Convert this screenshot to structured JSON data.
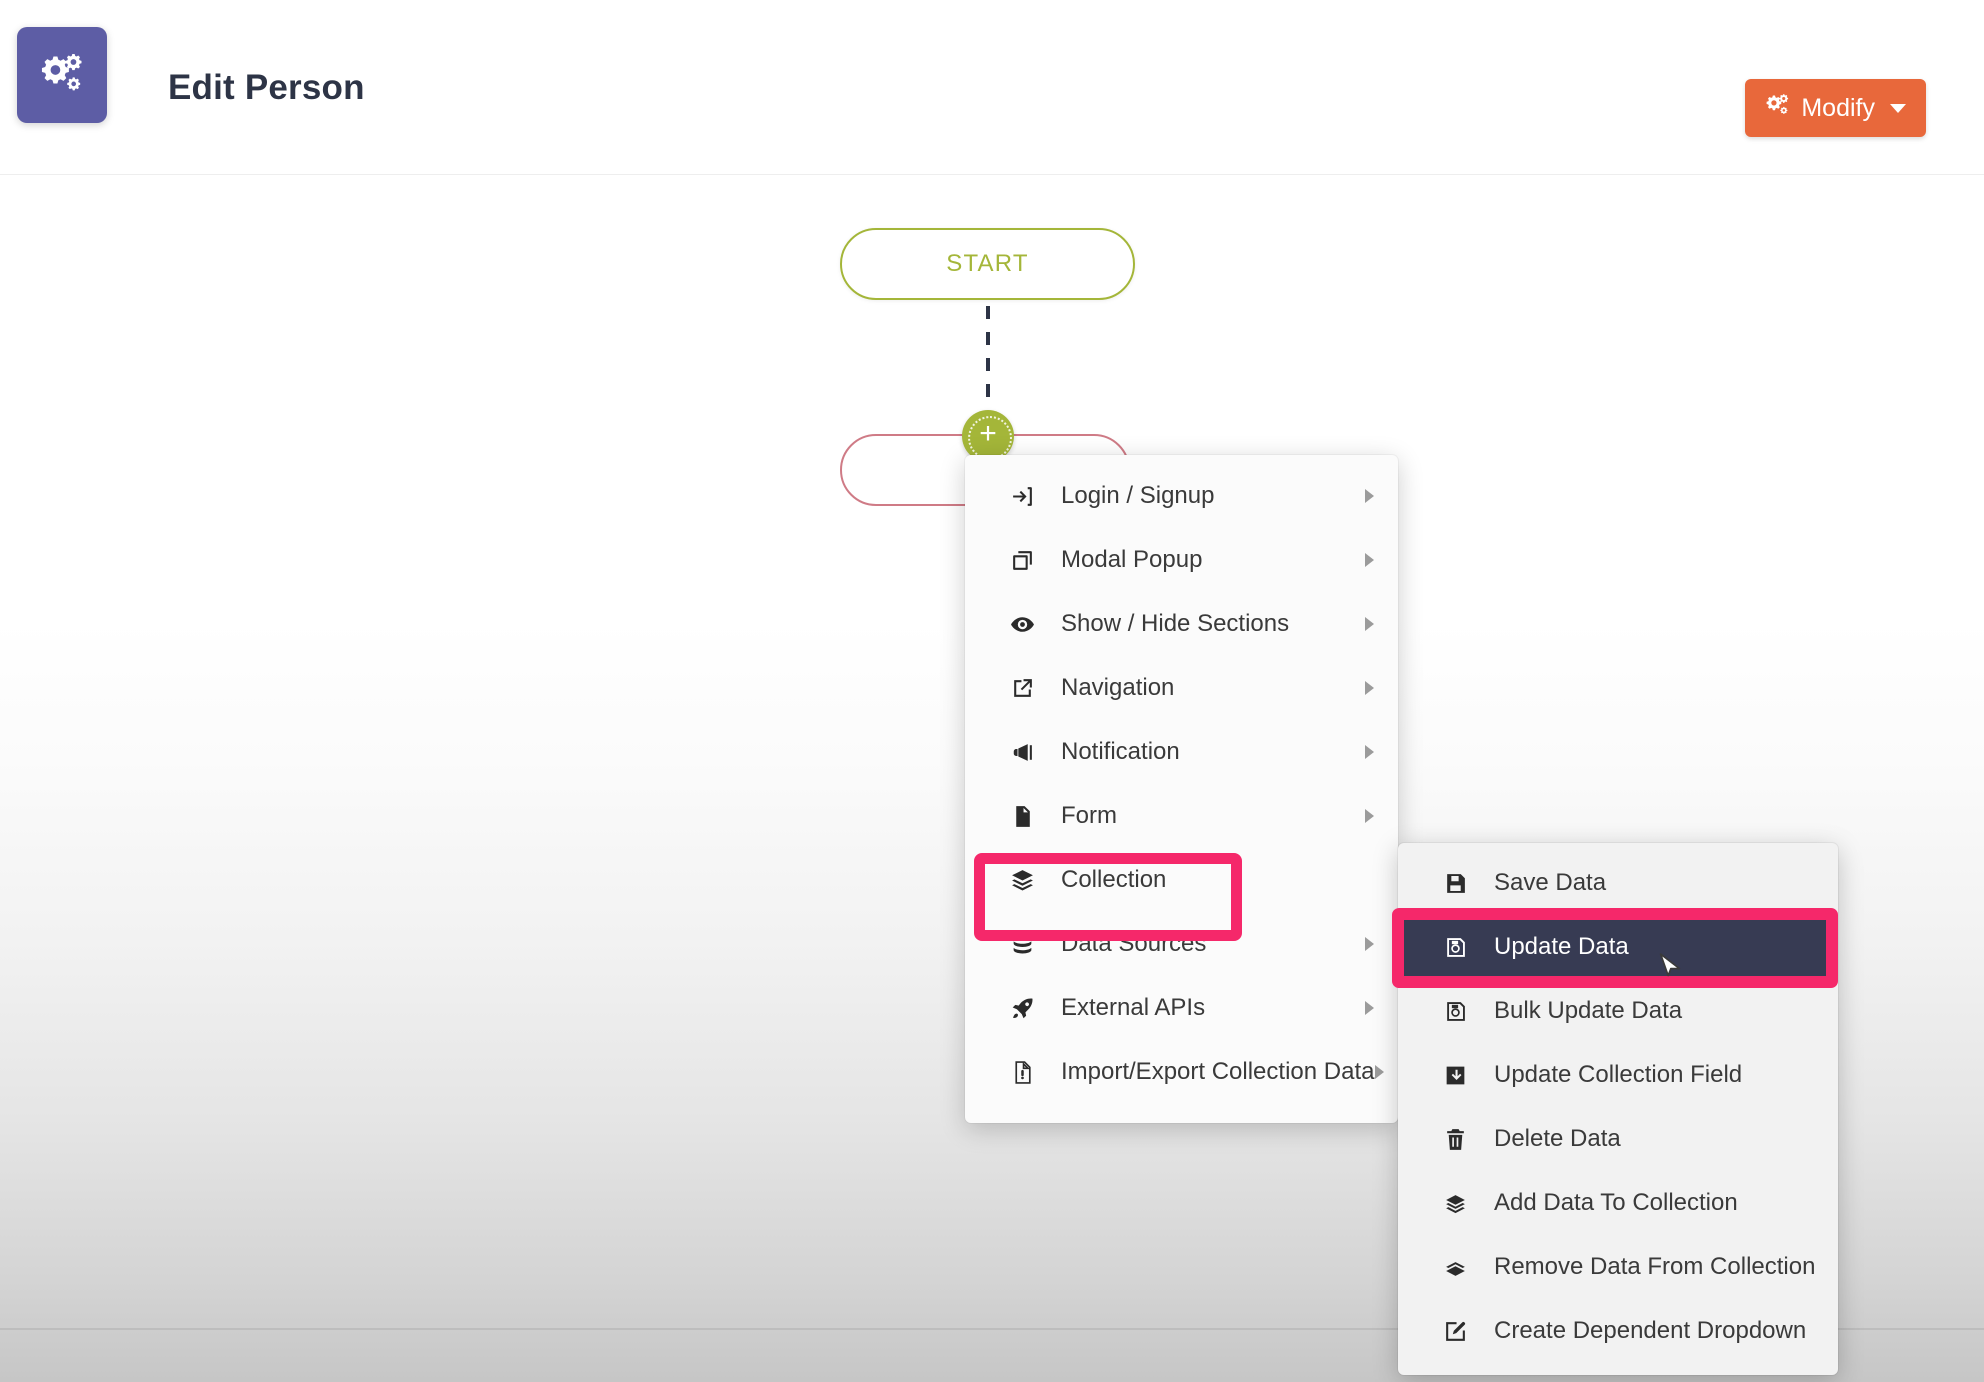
{
  "header": {
    "logo_icon": "gears-icon",
    "title": "Edit Person",
    "modify_button": {
      "label": "Modify",
      "icon": "gears-icon",
      "caret": "chevron-down-icon",
      "color": "#e8683b"
    }
  },
  "canvas": {
    "start_node": {
      "label": "START",
      "border_color": "#a4b639"
    },
    "add_node": {
      "icon": "plus-icon",
      "color": "#a4b639"
    },
    "action_node": {
      "label": "",
      "border_color": "#cf7b86"
    },
    "connector": "dashed-line"
  },
  "context_menu": {
    "items": [
      {
        "label": "Login / Signup",
        "icon": "login-icon",
        "has_submenu": true
      },
      {
        "label": "Modal Popup",
        "icon": "copy-window-icon",
        "has_submenu": true
      },
      {
        "label": "Show / Hide Sections",
        "icon": "eye-icon",
        "has_submenu": true
      },
      {
        "label": "Navigation",
        "icon": "external-link-icon",
        "has_submenu": true
      },
      {
        "label": "Notification",
        "icon": "megaphone-icon",
        "has_submenu": true
      },
      {
        "label": "Form",
        "icon": "document-icon",
        "has_submenu": true
      },
      {
        "label": "Collection",
        "icon": "layers-icon",
        "has_submenu": false,
        "highlighted": true
      },
      {
        "label": "Data Sources",
        "icon": "database-icon",
        "has_submenu": true
      },
      {
        "label": "External APIs",
        "icon": "rocket-icon",
        "has_submenu": true
      },
      {
        "label": "Import/Export Collection Data",
        "icon": "file-import-icon",
        "has_submenu": true
      }
    ]
  },
  "submenu": {
    "items": [
      {
        "label": "Save Data",
        "icon": "save-icon",
        "selected": false
      },
      {
        "label": "Update Data",
        "icon": "save-edit-icon",
        "selected": true,
        "highlighted": true
      },
      {
        "label": "Bulk Update Data",
        "icon": "save-edit-icon",
        "selected": false
      },
      {
        "label": "Update Collection Field",
        "icon": "download-box-icon",
        "selected": false
      },
      {
        "label": "Delete Data",
        "icon": "trash-icon",
        "selected": false
      },
      {
        "label": "Add Data To Collection",
        "icon": "layers-add-icon",
        "selected": false
      },
      {
        "label": "Remove Data From Collection",
        "icon": "layers-remove-icon",
        "selected": false
      },
      {
        "label": "Create Dependent Dropdown",
        "icon": "edit-square-icon",
        "selected": false
      }
    ]
  },
  "annotations": {
    "highlight_color": "#f5286a",
    "selected_row_color": "#373b53"
  },
  "cursor": {
    "icon": "mouse-pointer-icon"
  }
}
